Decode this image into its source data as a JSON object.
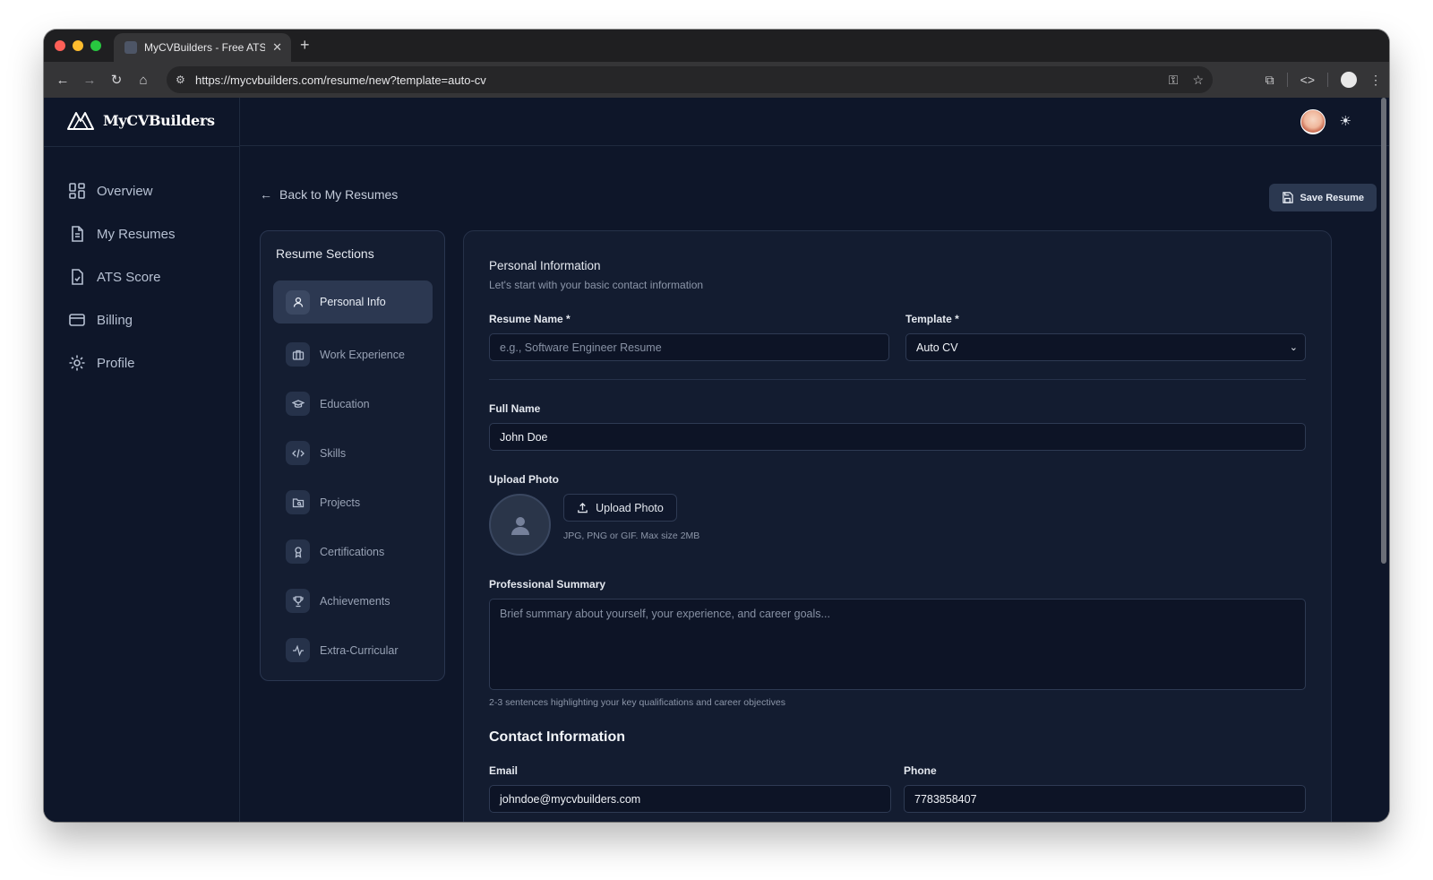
{
  "browser": {
    "tab_title": "MyCVBuilders - Free ATS-Fri",
    "url": "https://mycvbuilders.com/resume/new?template=auto-cv"
  },
  "brand": {
    "name": "MyCVBuilders"
  },
  "sidebar": {
    "items": [
      {
        "label": "Overview",
        "icon": "grid-icon"
      },
      {
        "label": "My Resumes",
        "icon": "document-icon"
      },
      {
        "label": "ATS Score",
        "icon": "file-check-icon"
      },
      {
        "label": "Billing",
        "icon": "credit-card-icon"
      },
      {
        "label": "Profile",
        "icon": "gear-icon"
      }
    ]
  },
  "header": {
    "back_label": "Back to My Resumes",
    "save_label": "Save Resume"
  },
  "sections": {
    "title": "Resume Sections",
    "items": [
      {
        "label": "Personal Info",
        "icon": "user-icon",
        "active": true
      },
      {
        "label": "Work Experience",
        "icon": "briefcase-icon"
      },
      {
        "label": "Education",
        "icon": "graduation-cap-icon"
      },
      {
        "label": "Skills",
        "icon": "code-icon"
      },
      {
        "label": "Projects",
        "icon": "folder-icon"
      },
      {
        "label": "Certifications",
        "icon": "award-icon"
      },
      {
        "label": "Achievements",
        "icon": "trophy-icon"
      },
      {
        "label": "Extra-Curricular",
        "icon": "activity-icon"
      }
    ]
  },
  "form": {
    "title": "Personal Information",
    "subtitle": "Let's start with your basic contact information",
    "resume_name_label": "Resume Name *",
    "resume_name_placeholder": "e.g., Software Engineer Resume",
    "template_label": "Template *",
    "template_value": "Auto CV",
    "full_name_label": "Full Name",
    "full_name_value": "John Doe",
    "upload_photo_label": "Upload Photo",
    "upload_button_label": "Upload Photo",
    "upload_hint": "JPG, PNG or GIF. Max size 2MB",
    "summary_label": "Professional Summary",
    "summary_placeholder": "Brief summary about yourself, your experience, and career goals...",
    "summary_hint": "2-3 sentences highlighting your key qualifications and career objectives",
    "contact_title": "Contact Information",
    "email_label": "Email",
    "email_value": "johndoe@mycvbuilders.com",
    "phone_label": "Phone",
    "phone_value": "7783858407"
  },
  "colors": {
    "page_bg": "#0e1629",
    "card_bg": "#131c30",
    "active_item": "#2c3851",
    "save_button": "#2b3850"
  }
}
